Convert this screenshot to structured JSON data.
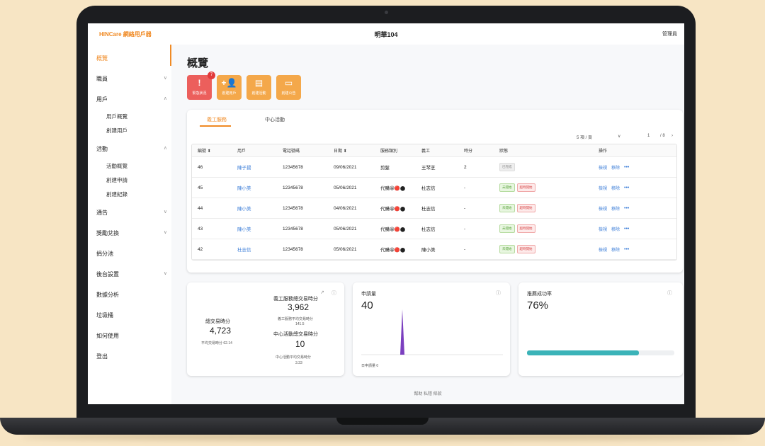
{
  "app": {
    "brand": "HINCare 網絡用戶器",
    "center_title": "明華104",
    "admin": "管理員"
  },
  "sidebar": {
    "items": [
      {
        "label": "概覽",
        "active": true,
        "chevron": ""
      },
      {
        "label": "職員",
        "chevron": "∨"
      },
      {
        "label": "用戶",
        "chevron": "∧"
      },
      {
        "label": "用戶概覽",
        "sub": true
      },
      {
        "label": "創建用戶",
        "sub": true
      },
      {
        "label": "活動",
        "chevron": "∧"
      },
      {
        "label": "活動概覽",
        "sub": true
      },
      {
        "label": "創建申請",
        "sub": true
      },
      {
        "label": "創建紀錄",
        "sub": true
      },
      {
        "label": "通告",
        "chevron": "∨"
      },
      {
        "label": "獎勵兌換",
        "chevron": "∨"
      },
      {
        "label": "捐分池",
        "chevron": ""
      },
      {
        "label": "後台設置",
        "chevron": "∨"
      },
      {
        "label": "數據分析",
        "chevron": ""
      },
      {
        "label": "垃圾桶",
        "chevron": ""
      },
      {
        "label": "如何使用",
        "chevron": ""
      },
      {
        "label": "登出",
        "chevron": ""
      }
    ]
  },
  "page": {
    "title": "概覽"
  },
  "quick_actions": [
    {
      "icon": "alert-icon",
      "glyph": "!",
      "label": "緊急狀況",
      "badge": "7",
      "color": "#ec5f5c"
    },
    {
      "icon": "add-user-icon",
      "glyph": "+👤",
      "label": "創建用戶",
      "color": "#f4a84a"
    },
    {
      "icon": "document-icon",
      "glyph": "▤",
      "label": "創建活動",
      "color": "#f4a84a"
    },
    {
      "icon": "monitor-icon",
      "glyph": "▭",
      "label": "創建公告",
      "color": "#f4a84a"
    }
  ],
  "tabs": [
    {
      "label": "義工服務",
      "active": true
    },
    {
      "label": "中心活動"
    }
  ],
  "pager": {
    "per_page": "5 項 / 頁",
    "dropdown": "∨",
    "page": "1",
    "total": "/ 8",
    "next": "›"
  },
  "table": {
    "headers": [
      "編號 ⬍",
      "用戶",
      "電話號碼",
      "日期 ⬍",
      "服務類別",
      "義工",
      "時分",
      "狀態",
      "操作"
    ],
    "rows": [
      {
        "id": "46",
        "user": "陳子揚",
        "phone": "12345678",
        "date": "09/06/2021",
        "category": "剪髮",
        "volunteer": "王琴芝",
        "hours": "2",
        "status": [
          "已完成"
        ],
        "status_style": [
          "gray"
        ]
      },
      {
        "id": "45",
        "user": "陳小美",
        "phone": "12345678",
        "date": "05/06/2021",
        "category": "代購😀🔴⬤",
        "volunteer": "杜志信",
        "hours": "-",
        "status": [
          "未開始",
          "超時開始"
        ],
        "status_style": [
          "green",
          "red"
        ]
      },
      {
        "id": "44",
        "user": "陳小美",
        "phone": "12345678",
        "date": "04/06/2021",
        "category": "代購😀🔴⬤",
        "volunteer": "杜志信",
        "hours": "-",
        "status": [
          "未開始",
          "超時開始"
        ],
        "status_style": [
          "green",
          "red"
        ]
      },
      {
        "id": "43",
        "user": "陳小美",
        "phone": "12345678",
        "date": "05/06/2021",
        "category": "代購😀🔴⬤",
        "volunteer": "杜志信",
        "hours": "-",
        "status": [
          "未開始",
          "超時開始"
        ],
        "status_style": [
          "green",
          "red"
        ]
      },
      {
        "id": "42",
        "user": "杜志信",
        "phone": "12345678",
        "date": "05/06/2021",
        "category": "代購😀🔴⬤",
        "volunteer": "陳小美",
        "hours": "-",
        "status": [
          "未開始",
          "超時開始"
        ],
        "status_style": [
          "green",
          "red"
        ]
      }
    ],
    "actions": [
      "檢視",
      "移除",
      "•••"
    ]
  },
  "stats": {
    "total_label": "總交易時分",
    "total_value": "4,723",
    "total_avg": "平均交易時分  62.14",
    "vol_label": "義工服務總交易時分",
    "vol_value": "3,962",
    "vol_avg_label": "義工服務平均交易時分",
    "vol_avg_value": "141.5",
    "center_label": "中心活動總交易時分",
    "center_value": "10",
    "center_avg_label": "中心活動平均交易時分",
    "center_avg_value": "3.33"
  },
  "applications": {
    "title": "申請量",
    "value": "40",
    "footer": "日申請量  0"
  },
  "matching": {
    "title": "推薦成功率",
    "value": "76%",
    "progress": 0.76,
    "bar_color": "#3bb3b8"
  },
  "footer": {
    "links": "幫助   私隱   條款"
  }
}
